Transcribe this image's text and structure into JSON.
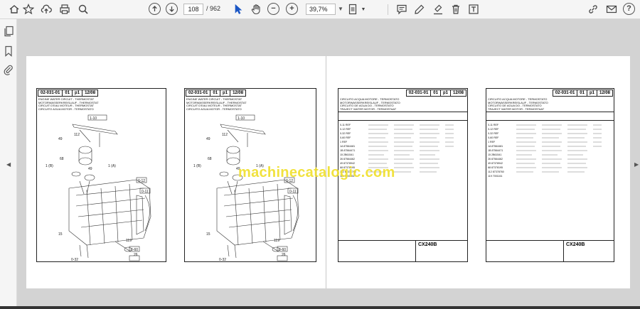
{
  "toolbar": {
    "page_current": "108",
    "page_total": "/ 962",
    "zoom": "39,7%"
  },
  "pages": [
    {
      "header": [
        "02-031-01",
        "01",
        "p1",
        "12/08"
      ],
      "titles": [
        "ENGINE WATER CIRCUIT - THERMOSTAT",
        "MOTORWASSERKREISLAUF - THERMOSTAT",
        "CIRCUIT D'EAU MOTEUR - THERMOSTAT",
        "CIRCUITO AGUA MOTOR - TERMOSTATO"
      ],
      "callouts": [
        "1-10",
        "49",
        "112",
        "68",
        "1 (B)",
        "49",
        "1 (A)",
        "0-12",
        "0-11",
        "15",
        "119",
        "26",
        "0-60",
        "0-32"
      ]
    },
    {
      "header": [
        "02-031-01",
        "01",
        "p1",
        "12/08"
      ],
      "titles": [
        "ENGINE WATER CIRCUIT - THERMOSTAT",
        "MOTORWASSERKREISLAUF - THERMOSTAT",
        "CIRCUIT D'EAU MOTEUR - THERMOSTAT",
        "CIRCUITO AGUA MOTOR - TERMOSTATO"
      ],
      "callouts": [
        "1-10",
        "49",
        "112",
        "68",
        "1 (B)",
        "49",
        "1 (A)",
        "0-12",
        "0-11",
        "15",
        "119",
        "26",
        "0-60",
        "0-32"
      ]
    },
    {
      "header": [
        "02-031-01",
        "01",
        "p1",
        "12/08"
      ],
      "titles": [
        "CIRCUITO ACQUA MOTORE - TERMOSTATO",
        "MOTORWASSERKREISLAUF - TERMOSTATO",
        "CIRCUITO DE AGUA DO - TERMOSTATO",
        "TRAJECT WATER MOTOR - TERMOSTAAT"
      ],
      "model": "CX240B",
      "rows": [
        "0-11  REF",
        "0-12  REF",
        "0-32  REF",
        "0-60  REF",
        "1  REF",
        "1A  87564481",
        "1B  87564471",
        "15  2B61541",
        "26  87564462",
        "49  87378942",
        "68  87378195",
        "112  87378760",
        "119  7001161"
      ]
    },
    {
      "header": [
        "02-031-01",
        "01",
        "p1",
        "12/08"
      ],
      "titles": [
        "CIRCUITO ACQUA MOTORE - TERMOSTATO",
        "MOTORWASSERKREISLAUF - TERMOSTATO",
        "CIRCUITO DE AGUA DO - TERMOSTATO",
        "TRAJECT WATER MOTOR - TERMOSTAAT"
      ],
      "model": "CX240B",
      "rows": [
        "0-11  REF",
        "0-12  REF",
        "0-32  REF",
        "0-60  REF",
        "1  REF",
        "1A  87564481",
        "1B  87564471",
        "15  2B61541",
        "26  87564462",
        "49  87378942",
        "68  87378195",
        "112  87378760",
        "119  7001161"
      ]
    }
  ],
  "watermark": "machinecatalogic.com",
  "colors": {
    "watermark": "#f0e02e",
    "viewer_bg": "#d3d3d3"
  }
}
